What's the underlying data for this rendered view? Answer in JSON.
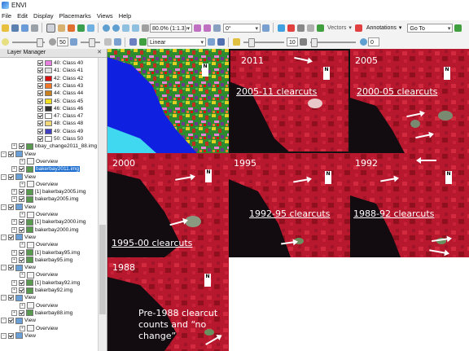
{
  "window": {
    "title": "ENVI"
  },
  "menu": [
    "File",
    "Edit",
    "Display",
    "Placemarks",
    "Views",
    "Help"
  ],
  "toolbar1": {
    "zoom_value": "80.0% (1:1.3)",
    "rotation_value": "0°",
    "vectors_label": "Vectors",
    "annotations_label": "Annotations",
    "goto_value": "Go To"
  },
  "toolbar2": {
    "brightness_value": "50",
    "stretch_value": "Linear",
    "sharpen_value": "10",
    "transparency_value": "0"
  },
  "layer_manager": {
    "title": "Layer Manager",
    "classes": [
      {
        "label": "40: Class 40",
        "color": "#e87fe0"
      },
      {
        "label": "41: Class 41",
        "color": "#e0e0e0"
      },
      {
        "label": "42: Class 42",
        "color": "#d81010"
      },
      {
        "label": "43: Class 43",
        "color": "#f07828"
      },
      {
        "label": "44: Class 44",
        "color": "#c88020"
      },
      {
        "label": "45: Class 45",
        "color": "#f0e020"
      },
      {
        "label": "46: Class 46",
        "color": "#303030"
      },
      {
        "label": "47: Class 47",
        "color": "#ffffff"
      },
      {
        "label": "48: Class 48",
        "color": "#f0d878"
      },
      {
        "label": "49: Class 49",
        "color": "#4040c0"
      },
      {
        "label": "50: Class 50",
        "color": "#ffffff"
      }
    ],
    "items": [
      {
        "kind": "file",
        "label": "bbay_change2011_88.img",
        "level": 1
      },
      {
        "kind": "view",
        "label": "View",
        "level": 0
      },
      {
        "kind": "overview",
        "label": "Overview",
        "level": 1
      },
      {
        "kind": "file",
        "label": "bakerbay2011.img",
        "level": 1,
        "selected": true
      },
      {
        "kind": "view",
        "label": "View",
        "level": 0
      },
      {
        "kind": "overview",
        "label": "Overview",
        "level": 1
      },
      {
        "kind": "file",
        "label": "[1] bakerbay2005.img",
        "level": 1
      },
      {
        "kind": "file",
        "label": "bakerbay2005.img",
        "level": 1
      },
      {
        "kind": "view",
        "label": "View",
        "level": 0
      },
      {
        "kind": "overview",
        "label": "Overview",
        "level": 1
      },
      {
        "kind": "file",
        "label": "[1] bakerbay2000.img",
        "level": 1
      },
      {
        "kind": "file",
        "label": "bakerbay2000.img",
        "level": 1
      },
      {
        "kind": "view",
        "label": "View",
        "level": 0
      },
      {
        "kind": "overview",
        "label": "Overview",
        "level": 1
      },
      {
        "kind": "file",
        "label": "[1] bakerbay95.img",
        "level": 1
      },
      {
        "kind": "file",
        "label": "bakerbay95.img",
        "level": 1
      },
      {
        "kind": "view",
        "label": "View",
        "level": 0
      },
      {
        "kind": "overview",
        "label": "Overview",
        "level": 1
      },
      {
        "kind": "file",
        "label": "[1] bakerbay92.img",
        "level": 1
      },
      {
        "kind": "file",
        "label": "bakerbay92.img",
        "level": 1
      },
      {
        "kind": "view",
        "label": "View",
        "level": 0
      },
      {
        "kind": "overview",
        "label": "Overview",
        "level": 1
      },
      {
        "kind": "file",
        "label": "bakerbay88.img",
        "level": 1
      },
      {
        "kind": "view",
        "label": "View",
        "level": 0
      },
      {
        "kind": "overview",
        "label": "Overview",
        "level": 1
      },
      {
        "kind": "view",
        "label": "View",
        "level": 0
      }
    ]
  },
  "views": [
    {
      "year": "",
      "caption": ""
    },
    {
      "year": "2011",
      "caption": "2005-11 clearcuts"
    },
    {
      "year": "2005",
      "caption": "2000-05 clearcuts"
    },
    {
      "year": "2000",
      "caption": "1995-00 clearcuts"
    },
    {
      "year": "1995",
      "caption": "1992-95 clearcuts"
    },
    {
      "year": "1992",
      "caption": "1988-92 clearcuts"
    },
    {
      "year": "1988",
      "caption": "Pre-1988 clearcut counts and “no change”"
    }
  ],
  "north_label": "N"
}
